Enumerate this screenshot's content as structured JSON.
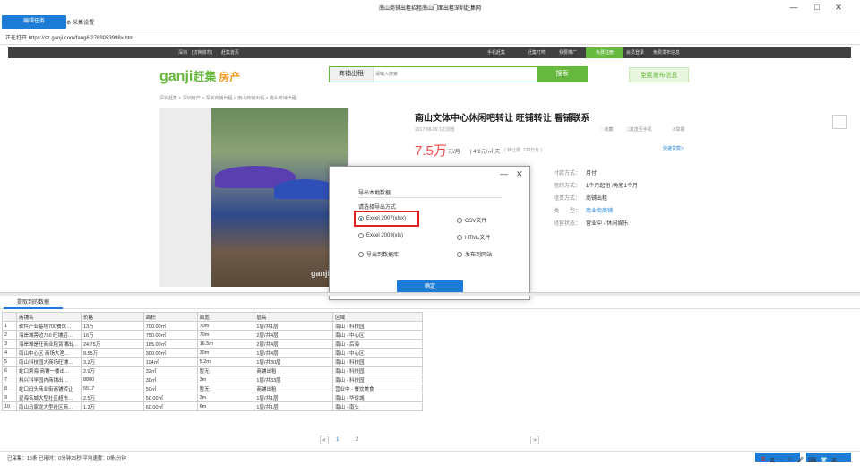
{
  "window": {
    "title": "南山商铺出租招租南山门面出租深圳赶集网",
    "minimize": "—",
    "maximize": "□",
    "close": "✕"
  },
  "toolbar": {
    "task_button": "编辑任务",
    "settings_label": "采集设置",
    "settings_icon": "gear-icon"
  },
  "address": {
    "prefix": "正在打开",
    "url": "https://sz.ganji.com/fang6/2769053998x.htm"
  },
  "site": {
    "topbar": {
      "city": "深圳",
      "switch_city": "[切换城市]",
      "home": "赶集首页",
      "mobile": "手机赶集",
      "ganji_app": "赶集叮咚",
      "promote": "我要推广",
      "free_register": "免费注册",
      "login": "会员登录",
      "free_post_top": "免费发布信息"
    },
    "logo_main": "ganji",
    "logo_cn": "赶集",
    "logo_sub": "房产",
    "search": {
      "category": "商铺出租",
      "placeholder": "请输入搜索",
      "button": "搜索"
    },
    "free_post": "免费发布信息",
    "breadcrumb": "深圳赶集 > 深圳房产 > 深圳商铺出租 > 南山商铺出租 > 南头商铺出租",
    "watermark": "ganji",
    "listing": {
      "title": "南山文体中心休闲吧转让 旺铺转让 看铺联系",
      "meta": "2017-08-09 1次浏览",
      "actions": [
        "收藏",
        "发送至手机",
        "举报"
      ],
      "price": "7.5万",
      "price_unit": "元/月",
      "price_sqm": "| 4.9元/㎡·天",
      "transfer": "( 转让费: 220万元 )",
      "quick_loan": "快速贷款>",
      "info": [
        {
          "label": "付款方式：",
          "value": "月付"
        },
        {
          "label": "租约方式：",
          "value": "1个月起租 /免租1个月"
        },
        {
          "label": "租赁方式：",
          "value": "商铺出租"
        },
        {
          "label": "类　　型：",
          "value": "商业街商铺"
        },
        {
          "label": "经营状态：",
          "value": "营业中 - 休闲娱乐"
        }
      ]
    }
  },
  "dialog": {
    "title": "导出本地数据",
    "subtitle": "请选择导出方式",
    "options": [
      "Excel 2007(xlsx)",
      "CSV文件",
      "Excel 2003(xls)",
      "HTML文件",
      "导出到数据库",
      "发布到网站"
    ],
    "selected": "Excel 2007(xlsx)",
    "ok": "确定",
    "minimize": "—",
    "close": "✕"
  },
  "tab": {
    "label": "提取到的数据"
  },
  "table": {
    "headers": [
      "",
      "商铺名",
      "价格",
      "面积",
      "面宽",
      "层高",
      "区域"
    ],
    "rows": [
      [
        "1",
        "软件产业基地700餐饮…",
        "13万",
        "700.00㎡",
        "70m",
        "1层/共1层",
        "南山 - 科技园"
      ],
      [
        "2",
        "海岸城旁边750  旺铺招…",
        "16万",
        "750.00㎡",
        "70m",
        "2层/共4层",
        "南山 - 中心区"
      ],
      [
        "3",
        "海岸城是旺商业租赁铺出…",
        "24.75万",
        "165.00㎡",
        "16.5m",
        "2层/共4层",
        "南山 - 后海"
      ],
      [
        "4",
        "南山中心区  商场大渔…",
        "8.55万",
        "300.00㎡",
        "30m",
        "1层/共4层",
        "南山 - 中心区"
      ],
      [
        "5",
        "南山科技园大商场旺铺…",
        "3.2万",
        "114㎡",
        "5.2m",
        "1层/共30层",
        "南山 - 科技园"
      ],
      [
        "6",
        "蛇口滨海  商铺一楼出…",
        "2.9万",
        "32㎡",
        "暂无",
        "商铺出租",
        "南山 - 科技园"
      ],
      [
        "7",
        "科兴科学园内商铺出…",
        "8800",
        "30㎡",
        "3m",
        "1层/共33层",
        "南山 - 科技园"
      ],
      [
        "8",
        "蛇口码头商业街商铺转让",
        "5517",
        "50㎡",
        "暂无",
        "商铺出租",
        "营业中 - 餐饮美食"
      ],
      [
        "9",
        "星海名城大型社区超市…",
        "2.5万",
        "50.00㎡",
        "3m",
        "1层/共1层",
        "南山 - 华侨城"
      ],
      [
        "10",
        "南山马家龙大型社区商…",
        "1.3万",
        "60.00㎡",
        "6m",
        "1层/共1层",
        "南山 - 南头"
      ]
    ]
  },
  "pager": {
    "prev": "<",
    "pages": [
      "1",
      "2"
    ],
    "next": ">"
  },
  "status": {
    "text": "已采集：15条  已用时：0分钟25秒  平均速度：0条/分钟"
  },
  "ime": {
    "items": [
      "英",
      "·,",
      "☺",
      "🎤",
      "⌨",
      "👕",
      "⊞"
    ]
  }
}
